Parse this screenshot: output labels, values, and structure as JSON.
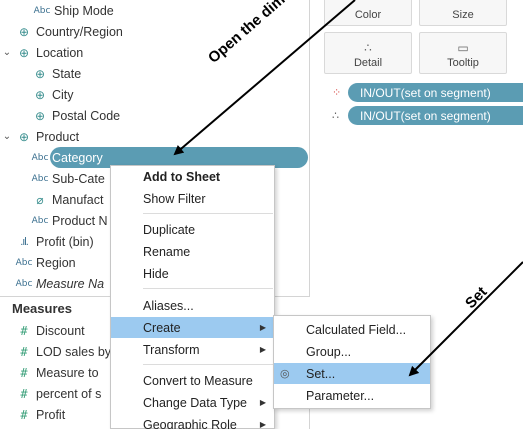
{
  "data_pane": {
    "dimensions": [
      {
        "label": "Ship Mode",
        "icon": "abc-icon"
      },
      {
        "label": "Country/Region",
        "icon": "globe-icon"
      },
      {
        "label": "Location",
        "icon": "hierarchy-icon"
      },
      {
        "label": "State",
        "icon": "globe-icon"
      },
      {
        "label": "City",
        "icon": "globe-icon"
      },
      {
        "label": "Postal Code",
        "icon": "globe-icon"
      },
      {
        "label": "Product",
        "icon": "hierarchy-icon"
      },
      {
        "label": "Category",
        "icon": "abc-icon"
      },
      {
        "label": "Sub-Cate",
        "icon": "abc-icon"
      },
      {
        "label": "Manufact",
        "icon": "paperclip-icon"
      },
      {
        "label": "Product N",
        "icon": "abc-icon"
      },
      {
        "label": "Profit (bin)",
        "icon": "bins-icon"
      },
      {
        "label": "Region",
        "icon": "abc-icon"
      },
      {
        "label": "Measure Na",
        "icon": "abc-icon"
      }
    ],
    "measures_header": "Measures",
    "measures": [
      {
        "label": "Discount"
      },
      {
        "label": "LOD sales by"
      },
      {
        "label": "Measure to"
      },
      {
        "label": "percent of s"
      },
      {
        "label": "Profit"
      }
    ],
    "abc_glyph": "Abc"
  },
  "marks_card": {
    "buttons": [
      {
        "label": "Color"
      },
      {
        "label": "Size"
      },
      {
        "label": "Detail"
      },
      {
        "label": "Tooltip"
      }
    ],
    "pills": [
      {
        "label": "IN/OUT(set on segment)"
      },
      {
        "label": "IN/OUT(set on segment)"
      }
    ]
  },
  "context_menu": {
    "items": [
      {
        "label": "Add to Sheet"
      },
      {
        "label": "Show Filter"
      },
      {
        "label": "Duplicate"
      },
      {
        "label": "Rename"
      },
      {
        "label": "Hide"
      },
      {
        "label": "Aliases..."
      },
      {
        "label": "Create"
      },
      {
        "label": "Transform"
      },
      {
        "label": "Convert to Measure"
      },
      {
        "label": "Change Data Type"
      },
      {
        "label": "Geographic Role"
      }
    ]
  },
  "create_submenu": {
    "items": [
      {
        "label": "Calculated Field..."
      },
      {
        "label": "Group..."
      },
      {
        "label": "Set..."
      },
      {
        "label": "Parameter..."
      }
    ]
  },
  "annotations": {
    "open_dimension": "Open the dimension",
    "set": "Set"
  },
  "colors": {
    "pill": "#5b9cb3",
    "menu_highlight": "#9ccaf0"
  }
}
